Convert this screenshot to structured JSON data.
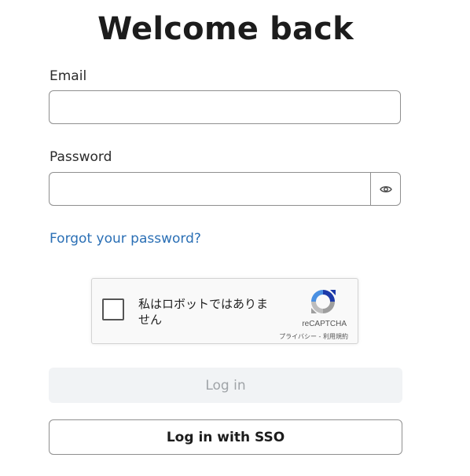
{
  "page": {
    "title": "Welcome back"
  },
  "form": {
    "email_label": "Email",
    "email_value": "",
    "password_label": "Password",
    "password_value": "",
    "forgot_link": "Forgot your password?",
    "login_button": "Log in",
    "sso_button": "Log in with SSO"
  },
  "captcha": {
    "checkbox_text": "私はロボットではありません",
    "brand": "reCAPTCHA",
    "privacy_link": "プライバシー",
    "separator": " - ",
    "terms_link": "利用規約",
    "checked": false
  },
  "icons": {
    "password_toggle": "eye-icon",
    "captcha_logo": "recaptcha-logo-icon"
  },
  "colors": {
    "link": "#2a6fb5",
    "login_disabled_bg": "#f1f3f5",
    "login_disabled_text": "#a0a4a8",
    "border": "#8f8f8f"
  }
}
